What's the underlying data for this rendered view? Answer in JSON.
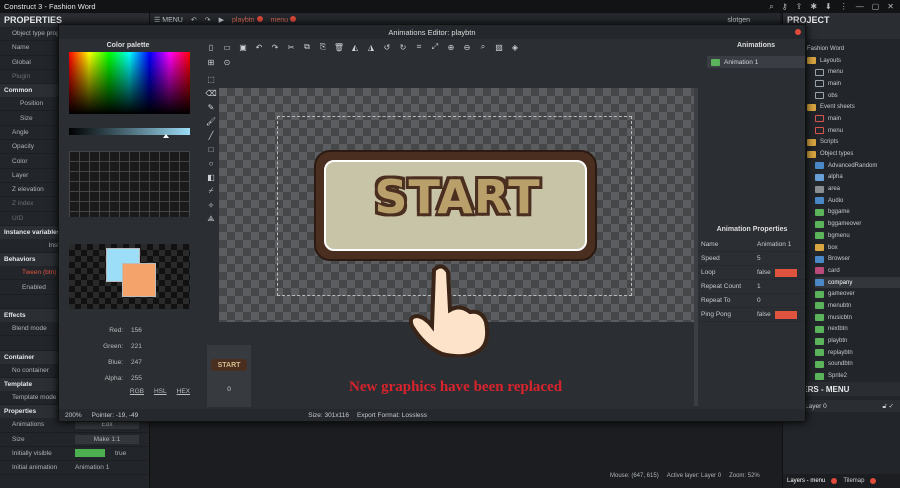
{
  "window": {
    "title": "Construct 3 - Fashion Word"
  },
  "toolbar": {
    "menu_label": "MENU",
    "tab1": "playbtn",
    "tab2": "menu",
    "user": "slotgen"
  },
  "properties": {
    "title": "PROPERTIES",
    "rows1": [
      "Object type prop",
      "Name",
      "Global",
      "Plugin"
    ],
    "common_title": "Common",
    "common_rows": [
      "Position",
      "Size",
      "Angle",
      "Opacity",
      "Color",
      "Layer",
      "Z elevation",
      "Z index",
      "UID"
    ],
    "instance_vars_title": "Instance variables",
    "inst_btn": "Inst",
    "behaviors_title": "Behaviors",
    "behavior_name": "Tween (btn)",
    "behavior_enabled": "Enabled",
    "effects_title": "Effects",
    "blend_mode": "Blend mode",
    "container_title": "Container",
    "no_container": "No container",
    "template_title": "Template",
    "template_mode": "Template mode",
    "properties_title": "Properties",
    "animations": "Animations",
    "edit_btn": "Edit",
    "size": "Size",
    "make_btn": "Make 1:1",
    "initially_visible": "Initially visible",
    "visible_value": "true",
    "initial_animation": "Initial animation",
    "initial_animation_value": "Animation 1"
  },
  "dialog": {
    "title": "Animations Editor: playbtn",
    "palette_title": "Color palette",
    "red_label": "Red:",
    "red": "156",
    "green_label": "Green:",
    "green": "221",
    "blue_label": "Blue:",
    "blue": "247",
    "alpha_label": "Alpha:",
    "alpha": "255",
    "rgb": "RGB",
    "hsl": "HSL",
    "hex": "HEX",
    "canvas_text": "START",
    "frame_label": "START",
    "frame_index": "0",
    "zoom": "200%",
    "pointer": "Pointer: -19, -49",
    "size_info": "Size: 301x116",
    "export_format": "Export Format: Lossless",
    "caption": "New graphics have been replaced",
    "animations_title": "Animations",
    "animation_item": "Animation 1",
    "anim_props_title": "Animation Properties",
    "anim_props": [
      {
        "name": "Name",
        "value": "Animation 1"
      },
      {
        "name": "Speed",
        "value": "5"
      },
      {
        "name": "Loop",
        "value": "false"
      },
      {
        "name": "Repeat Count",
        "value": "1"
      },
      {
        "name": "Repeat To",
        "value": "0"
      },
      {
        "name": "Ping Pong",
        "value": "false"
      }
    ]
  },
  "project": {
    "title": "PROJECT",
    "root": "Fashion Word",
    "layouts": "Layouts",
    "layout_items": [
      "menu",
      "main",
      "obs"
    ],
    "event_sheets": "Event sheets",
    "event_items": [
      "main",
      "menu"
    ],
    "scripts": "Scripts",
    "object_types": "Object types",
    "objects": [
      "AdvancedRandom",
      "alpha",
      "area",
      "Audio",
      "bggame",
      "bggameover",
      "bgmenu",
      "box",
      "Browser",
      "card",
      "company",
      "gameover",
      "menubtn",
      "musicbtn",
      "nextbtn",
      "playbtn",
      "replaybtn",
      "soundbtn",
      "Sprite2"
    ]
  },
  "layers": {
    "title": "LAYERS - MENU",
    "layer": "Layer 0",
    "tab1": "Layers - menu",
    "tab2": "Tilemap"
  },
  "status": {
    "mouse": "Mouse: (647, 615)",
    "active_layer": "Active layer: Layer 0",
    "zoom": "Zoom: 52%"
  },
  "colors": {
    "accent": "#e0533f",
    "swatch1": "#9cddf7",
    "swatch2": "#f4a36b",
    "caption": "#d9232d",
    "button_border": "#4a2e1f",
    "button_fill": "#c8c4a8"
  }
}
